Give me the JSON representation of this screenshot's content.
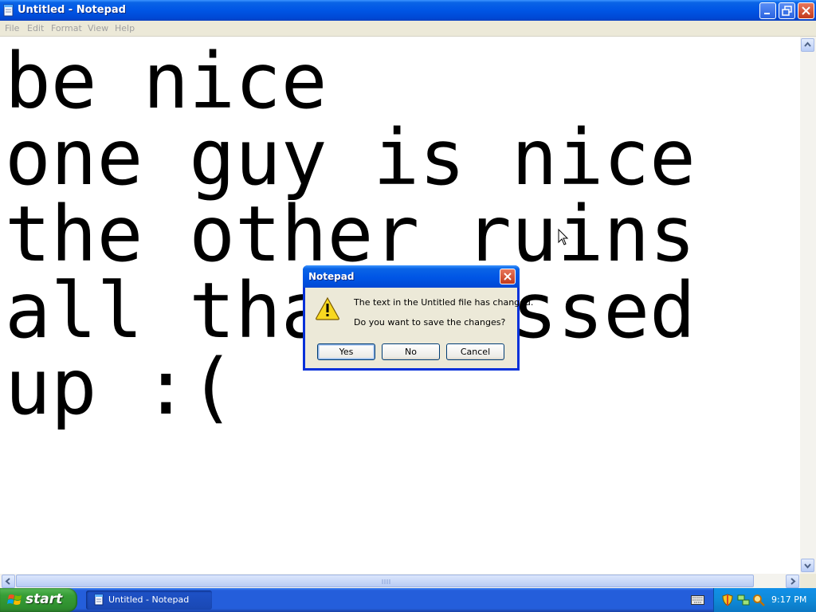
{
  "window": {
    "title": "Untitled - Notepad",
    "icon": "notepad-icon",
    "caption_buttons": [
      "minimize-icon",
      "restore-icon",
      "close-icon"
    ]
  },
  "menu": {
    "file": "File",
    "edit": "Edit",
    "format": "Format",
    "view": "View",
    "help": "Help"
  },
  "editor": {
    "lines": [
      "be nice",
      "one guy is nice",
      "the other ruins",
      "all that messed",
      "up :("
    ]
  },
  "dialog": {
    "title": "Notepad",
    "icon": "warning-icon",
    "message_line1": "The text in the Untitled file has changed.",
    "message_line2": "Do you want to save the changes?",
    "yes_label": "Yes",
    "no_label": "No",
    "cancel_label": "Cancel"
  },
  "taskbar": {
    "start_label": "start",
    "task_notepad_label": "Untitled - Notepad",
    "clock": "9:17 PM"
  },
  "colors": {
    "titlebar": "#0055e5",
    "taskbar": "#245edb",
    "start_button": "#379e37",
    "tray": "#0f8ad8",
    "dialog_face": "#ece9d8"
  }
}
